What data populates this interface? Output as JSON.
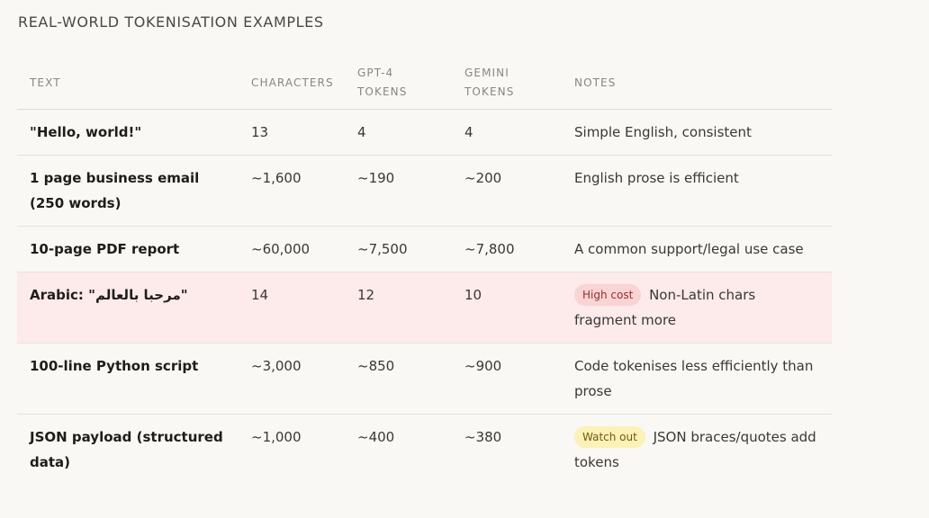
{
  "section_title": "REAL-WORLD TOKENISATION EXAMPLES",
  "columns": {
    "text": "TEXT",
    "characters": "CHARACTERS",
    "gpt4_line1": "GPT-4",
    "gpt4_line2": "TOKENS",
    "gemini_line1": "GEMINI",
    "gemini_line2": "TOKENS",
    "notes": "NOTES"
  },
  "rows": [
    {
      "text": "\"Hello, world!\"",
      "characters": "13",
      "gpt4": "4",
      "gemini": "4",
      "badge": "",
      "note": "Simple English, consistent"
    },
    {
      "text": "1 page business email (250 words)",
      "characters": "~1,600",
      "gpt4": "~190",
      "gemini": "~200",
      "badge": "",
      "note": "English prose is efficient"
    },
    {
      "text": "10-page PDF report",
      "characters": "~60,000",
      "gpt4": "~7,500",
      "gemini": "~7,800",
      "badge": "",
      "note": "A common support/legal use case"
    },
    {
      "text": "Arabic: \"مرحبا بالعالم\"",
      "characters": "14",
      "gpt4": "12",
      "gemini": "10",
      "badge": "High cost",
      "note": "Non-Latin chars fragment more"
    },
    {
      "text": "100-line Python script",
      "characters": "~3,000",
      "gpt4": "~850",
      "gemini": "~900",
      "badge": "",
      "note": "Code tokenises less efficiently than prose"
    },
    {
      "text": "JSON payload (structured data)",
      "characters": "~1,000",
      "gpt4": "~400",
      "gemini": "~380",
      "badge": "Watch out",
      "note": "JSON braces/quotes add tokens"
    }
  ],
  "colors": {
    "highlight_row": "#fdeaea",
    "badge_high_cost": "#f9d4d4",
    "badge_watch_out": "#fcf1b6"
  }
}
